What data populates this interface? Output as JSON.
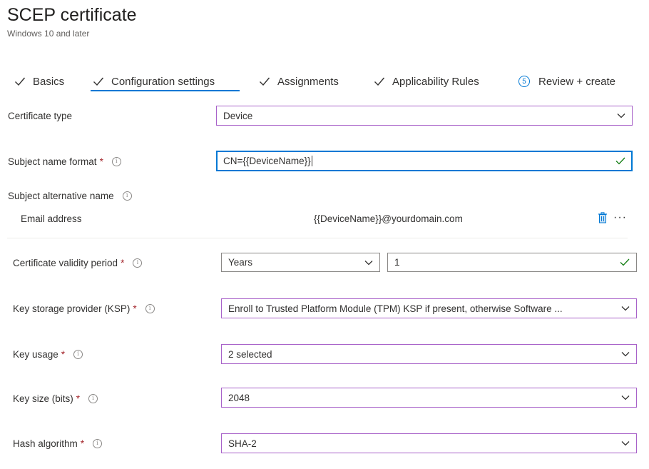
{
  "header": {
    "title": "SCEP certificate",
    "subtitle": "Windows 10 and later"
  },
  "tabs": [
    {
      "label": "Basics",
      "state": "complete"
    },
    {
      "label": "Configuration settings",
      "state": "complete-active"
    },
    {
      "label": "Assignments",
      "state": "complete"
    },
    {
      "label": "Applicability Rules",
      "state": "complete"
    },
    {
      "label": "Review + create",
      "state": "pending",
      "step": "5"
    }
  ],
  "form": {
    "certificate_type": {
      "label": "Certificate type",
      "value": "Device"
    },
    "subject_name_format": {
      "label": "Subject name format",
      "required": "*",
      "value": "CN={{DeviceName}}"
    },
    "subject_alternative_name": {
      "label": "Subject alternative name",
      "row": {
        "attribute": "Email address",
        "value": "{{DeviceName}}@yourdomain.com",
        "more": "···"
      }
    },
    "validity_period": {
      "label": "Certificate validity period",
      "required": "*",
      "unit": "Years",
      "value": "1"
    },
    "ksp": {
      "label": "Key storage provider (KSP)",
      "required": "*",
      "value": "Enroll to Trusted Platform Module (TPM) KSP if present, otherwise Software ..."
    },
    "key_usage": {
      "label": "Key usage",
      "required": "*",
      "value": "2 selected"
    },
    "key_size": {
      "label": "Key size (bits)",
      "required": "*",
      "value": "2048"
    },
    "hash_algorithm": {
      "label": "Hash algorithm",
      "required": "*",
      "value": "SHA-2"
    }
  },
  "colors": {
    "accent": "#0078d4",
    "field_border": "#a862c9",
    "required": "#a4262c",
    "success": "#107c10"
  },
  "icons": {
    "tab_done": "checkmark-icon",
    "info": "info-icon",
    "dropdown": "chevron-down-icon",
    "valid": "checkmark-icon",
    "delete": "trash-icon"
  }
}
